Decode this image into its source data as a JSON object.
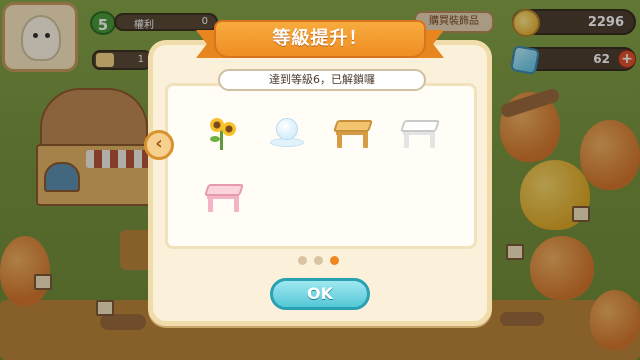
{
  "hud": {
    "level": "5",
    "xp_label": "權利",
    "xp_value": "0",
    "item_count": "1",
    "shop_button": "購買裝飾品",
    "coins": "2296",
    "gems": "62",
    "plus_symbol": "+"
  },
  "dialog": {
    "title": "等級提升！",
    "notice": "達到等級6，已解鎖囉",
    "unlocked_items": [
      {
        "name": "sunflower-decor",
        "icon": "sunflower-icon"
      },
      {
        "name": "snowball-decor",
        "icon": "snowball-icon"
      },
      {
        "name": "wooden-table",
        "icon": "wooden-table-icon"
      },
      {
        "name": "white-table",
        "icon": "white-table-icon"
      },
      {
        "name": "pink-table",
        "icon": "pink-table-icon"
      }
    ],
    "pagination": {
      "total": 3,
      "current": 3
    },
    "prev_symbol": "‹",
    "ok_label": "OK"
  },
  "colors": {
    "ribbon": "#ef8e23",
    "ok_button": "#54c7d6",
    "dialog_bg": "#fbf1db",
    "active_dot": "#f0861e"
  }
}
